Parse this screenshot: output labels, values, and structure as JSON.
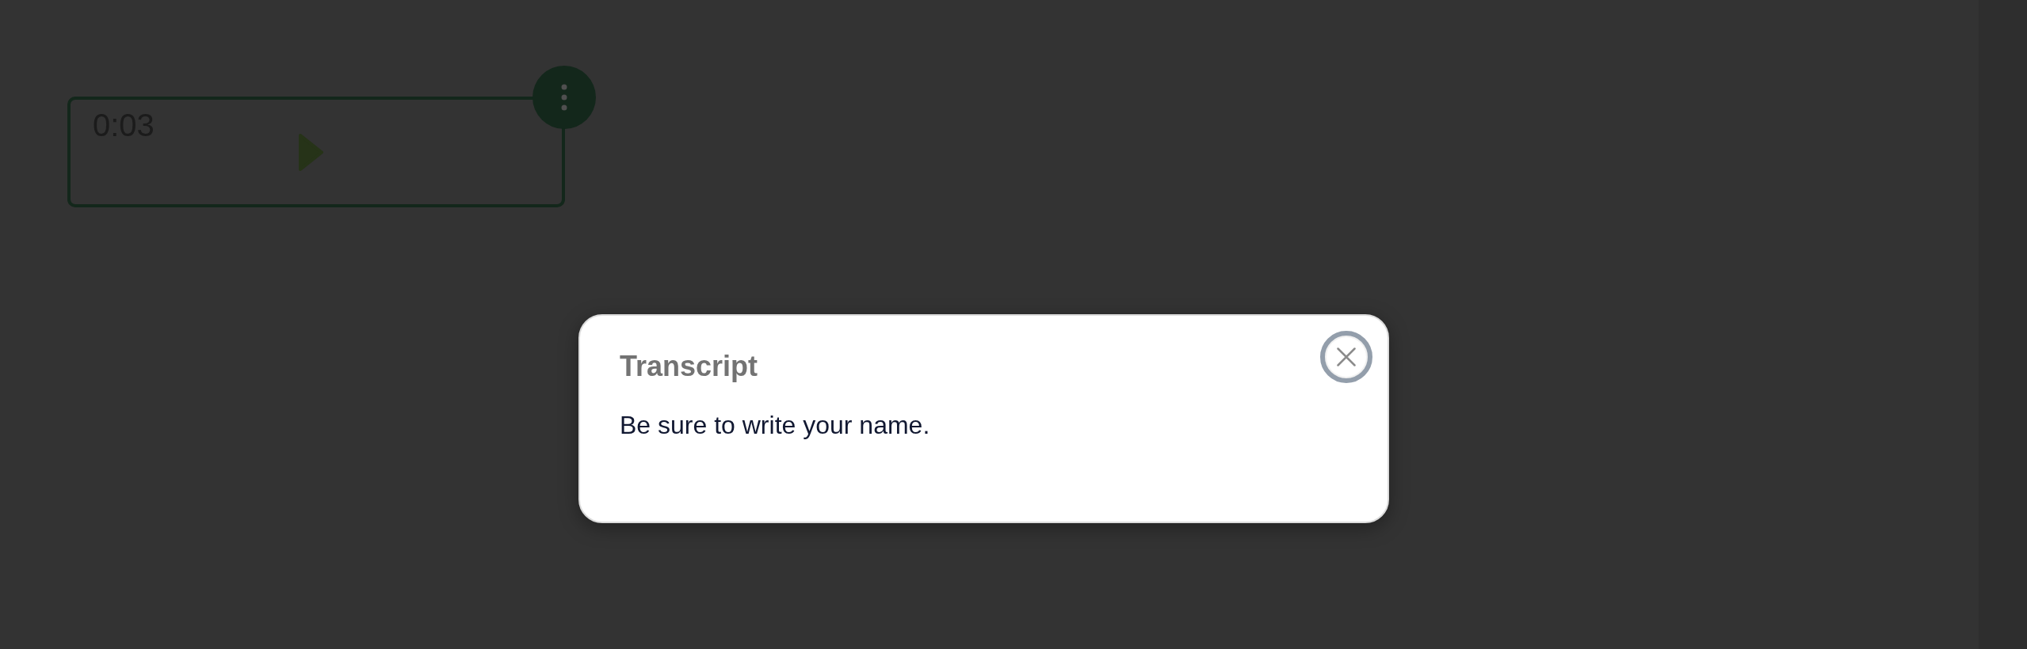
{
  "audio_player": {
    "time": "0:03",
    "playing": false
  },
  "transcript_dialog": {
    "title": "Transcript",
    "text": "Be sure to write your name."
  }
}
